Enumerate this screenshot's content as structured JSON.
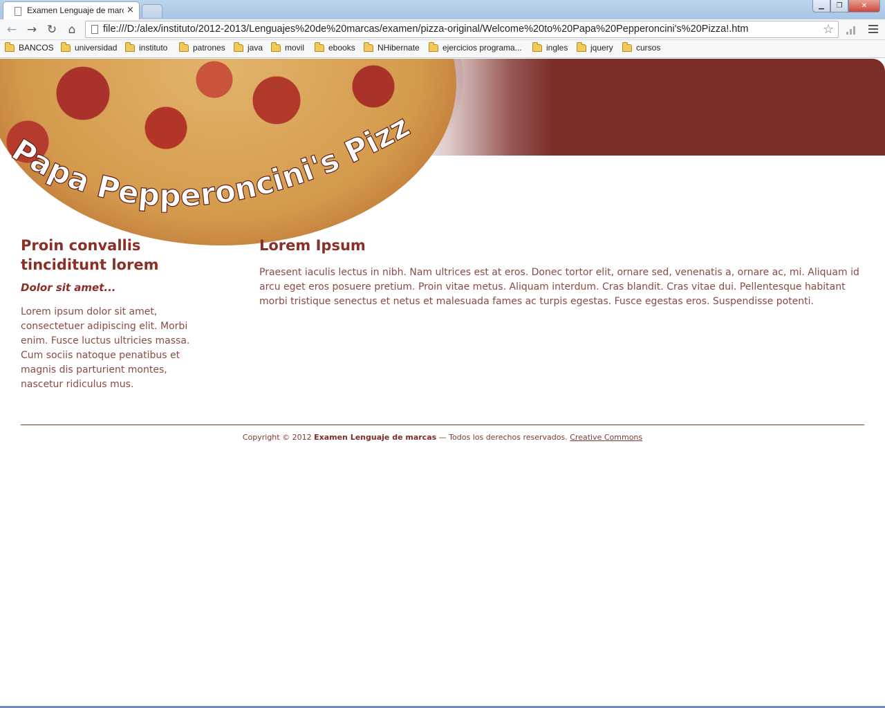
{
  "browser": {
    "tab_title": "Examen Lenguaje de marc",
    "tab_close": "×",
    "url": "file:///D:/alex/instituto/2012-2013/Lenguajes%20de%20marcas/examen/pizza-original/Welcome%20to%20Papa%20Pepperoncini's%20Pizza!.htm",
    "window_buttons": {
      "minimize": "▁",
      "maximize": "❐",
      "close": "✕"
    },
    "nav_icons": {
      "back": "←",
      "forward": "→",
      "reload": "↻",
      "home": "⌂",
      "star": "☆"
    },
    "bookmarks": [
      "BANCOS",
      "universidad",
      "instituto",
      "patrones",
      "java",
      "movil",
      "ebooks",
      "NHibernate",
      "ejercicios programa...",
      "ingles",
      "jquery",
      "cursos"
    ]
  },
  "header": {
    "logo_text": "Papa Pepperoncini's Pizza"
  },
  "sidebar": {
    "title": "Proin convallis tinciditunt lorem",
    "subtitle": "Dolor sit amet...",
    "text": "Lorem ipsum dolor sit amet, consectetuer adipiscing elit. Morbi enim. Fusce luctus ultricies massa. Cum sociis natoque penatibus et magnis dis parturient montes, nascetur ridiculus mus."
  },
  "main": {
    "title": "Lorem Ipsum",
    "text": "Praesent iaculis lectus in nibh. Nam ultrices est at eros. Donec tortor elit, ornare sed, venenatis a, ornare ac, mi. Aliquam id arcu eget eros posuere pretium. Proin vitae metus. Aliquam interdum. Cras blandit. Cras vitae dui. Pellentesque habitant morbi tristique senectus et netus et malesuada fames ac turpis egestas. Fusce egestas eros. Suspendisse potenti."
  },
  "footer": {
    "prefix": "Copyright © 2012",
    "site_name": "Examen Lenguaje de marcas",
    "middle": "— Todos los derechos reservados.",
    "link_text": "Creative Commons"
  },
  "colors": {
    "brand": "#8b2e28",
    "header_band": "#7b2d28",
    "body_text": "#8b4a44"
  }
}
